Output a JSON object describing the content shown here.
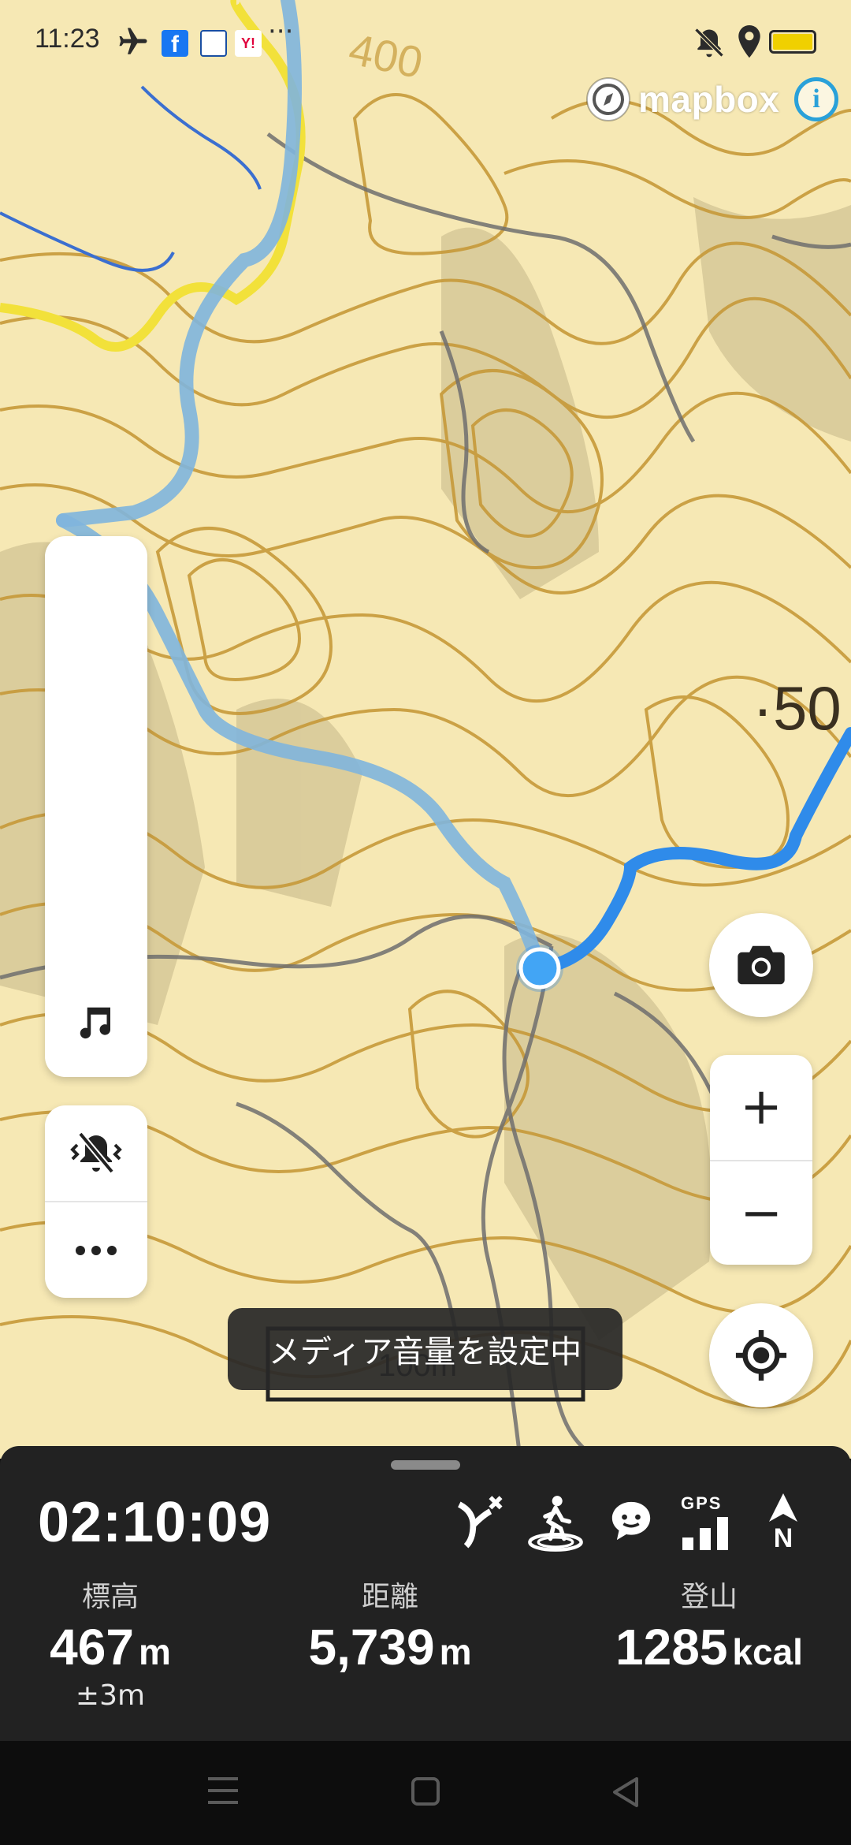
{
  "status_bar": {
    "time": "11:23",
    "icons": [
      "airplane-icon",
      "facebook-icon",
      "news-app-icon",
      "yahoo-icon",
      "more-icon",
      "mute-icon",
      "location-icon",
      "battery-icon"
    ],
    "more": "···"
  },
  "map": {
    "attribution": "mapbox",
    "info_label": "i",
    "contour_labels": [
      "400",
      "·50"
    ],
    "scale_label": "100m",
    "colors": {
      "base": "#f6e8b4",
      "contour": "#c79a3a",
      "road": "#6f6f6f",
      "track_past": "#7fb5dd",
      "track_current": "#2f8bea",
      "route_yellow": "#f2e13a"
    }
  },
  "left_panel": {
    "music_icon": "music-note-icon",
    "vibrate_icon": "vibrate-off-icon",
    "more_icon": "more-horizontal-icon"
  },
  "right_controls": {
    "camera_icon": "camera-icon",
    "zoom_in": "+",
    "zoom_out": "−",
    "locate_icon": "my-location-icon"
  },
  "toast": {
    "message": "メディア音量を設定中"
  },
  "bottom_sheet": {
    "timer": "02:10:09",
    "icons": [
      "trail-icon",
      "walker-icon",
      "chat-icon",
      "gps-signal-icon",
      "north-icon"
    ],
    "gps_label": "GPS",
    "north_label": "N",
    "stats": [
      {
        "label": "標高",
        "value": "467",
        "unit": "m",
        "sub": "±3m"
      },
      {
        "label": "距離",
        "value": "5,739",
        "unit": "m"
      },
      {
        "label": "登山",
        "value": "1285",
        "unit": "kcal"
      }
    ]
  },
  "nav_bar": {
    "icons": [
      "menu-icon",
      "home-icon",
      "back-icon"
    ]
  }
}
